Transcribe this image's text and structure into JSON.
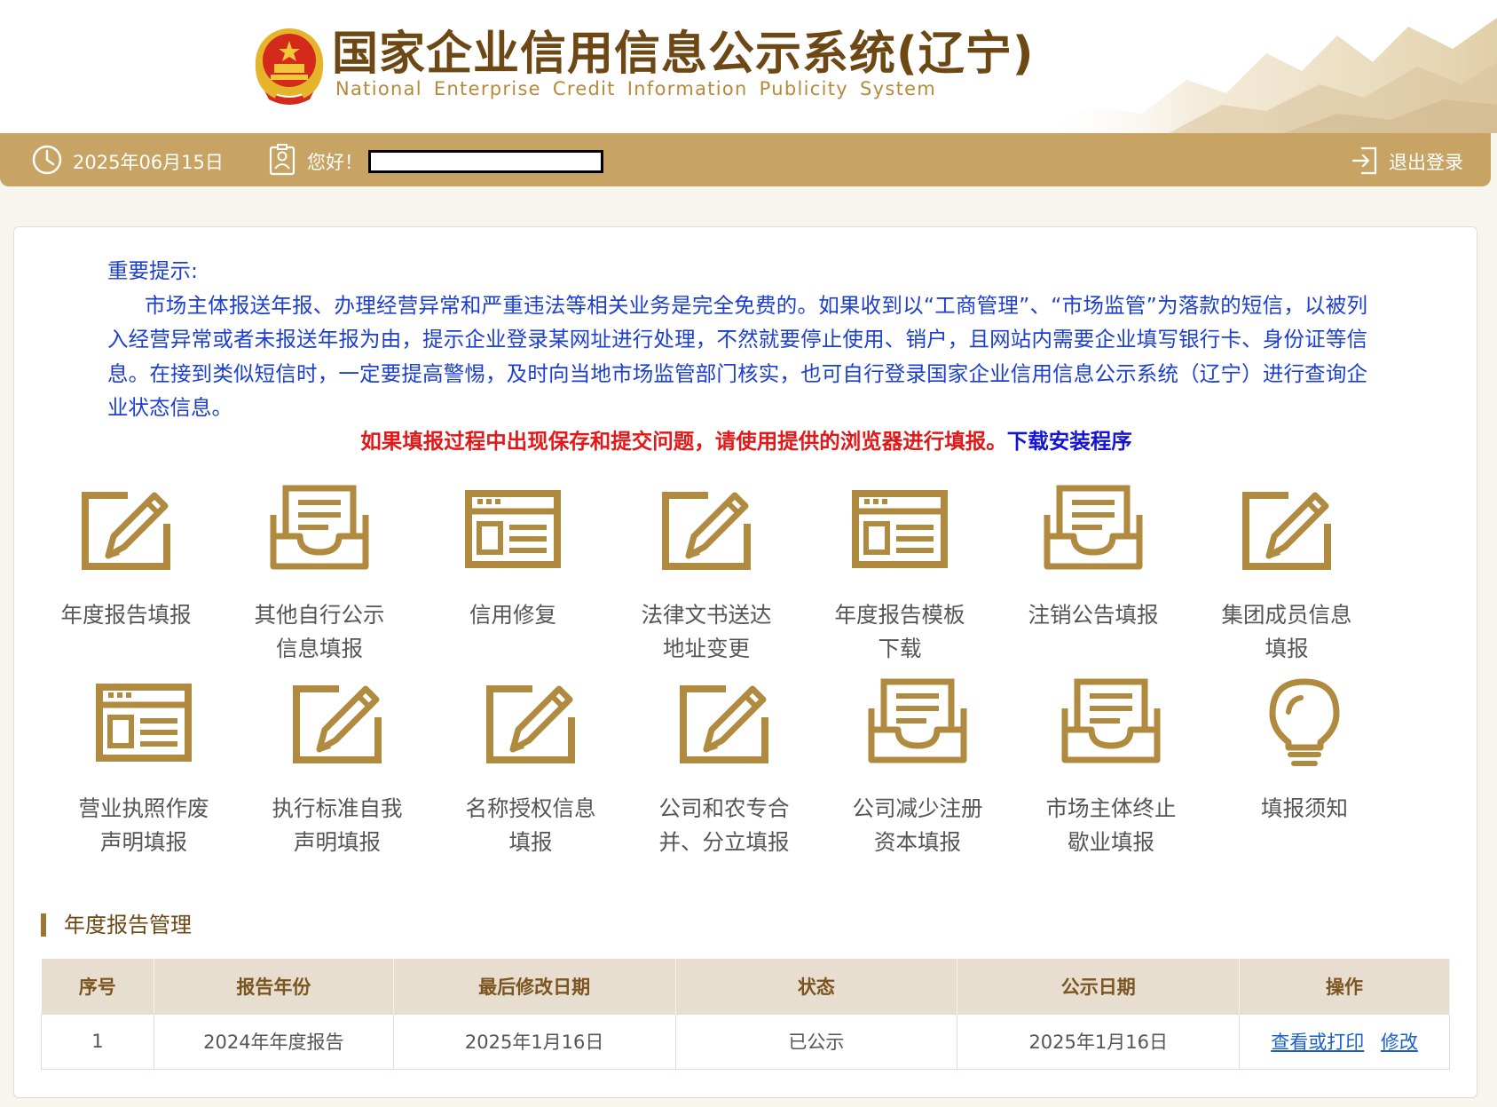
{
  "header": {
    "title": "国家企业信用信息公示系统(辽宁)",
    "subtitle": "National Enterprise Credit Information Publicity System"
  },
  "topbar": {
    "date": "2025年06月15日",
    "greeting": "您好！",
    "logout": "退出登录",
    "icons": [
      "clock-icon",
      "user-card-icon",
      "logout-icon"
    ]
  },
  "notice": {
    "title": "重要提示:",
    "body": "市场主体报送年报、办理经营异常和严重违法等相关业务是完全免费的。如果收到以“工商管理”、“市场监管”为落款的短信，以被列入经营异常或者未报送年报为由，提示企业登录某网址进行处理，不然就要停止使用、销户，且网站内需要企业填写银行卡、身份证等信息。在接到类似短信时，一定要提高警惕，及时向当地市场监管部门核实，也可自行登录国家企业信用信息公示系统（辽宁）进行查询企业状态信息。",
    "warning": "如果填报过程中出现保存和提交问题，请使用提供的浏览器进行填报。",
    "download_link": "下载安装程序"
  },
  "tiles": [
    {
      "label": "年度报告填报",
      "icon": "edit-icon"
    },
    {
      "label": "其他自行公示\n信息填报",
      "icon": "inbox-icon"
    },
    {
      "label": "信用修复",
      "icon": "browser-window-icon"
    },
    {
      "label": "法律文书送达\n地址变更",
      "icon": "edit-icon"
    },
    {
      "label": "年度报告模板\n下载",
      "icon": "browser-window-icon"
    },
    {
      "label": "注销公告填报",
      "icon": "inbox-icon"
    },
    {
      "label": "集团成员信息\n填报",
      "icon": "edit-icon"
    },
    {
      "label": "营业执照作废\n声明填报",
      "icon": "browser-window-icon"
    },
    {
      "label": "执行标准自我\n声明填报",
      "icon": "edit-icon"
    },
    {
      "label": "名称授权信息\n填报",
      "icon": "edit-icon"
    },
    {
      "label": "公司和农专合\n并、分立填报",
      "icon": "edit-icon"
    },
    {
      "label": "公司减少注册\n资本填报",
      "icon": "inbox-icon"
    },
    {
      "label": "市场主体终止\n歇业填报",
      "icon": "inbox-icon"
    },
    {
      "label": "填报须知",
      "icon": "lightbulb-icon"
    }
  ],
  "section": {
    "title": "年度报告管理"
  },
  "table": {
    "headers": [
      "序号",
      "报告年份",
      "最后修改日期",
      "状态",
      "公示日期",
      "操作"
    ],
    "rows": [
      {
        "index": "1",
        "year": "2024年年度报告",
        "modified": "2025年1月16日",
        "status": "已公示",
        "published": "2025年1月16日",
        "actions": [
          "查看或打印",
          "修改"
        ]
      }
    ]
  },
  "colors": {
    "gold_bar": "#c8a464",
    "icon_gold": "#b08a3e",
    "title_brown": "#6e4814",
    "notice_blue": "#1c3fd2",
    "warning_red": "#e31818"
  }
}
